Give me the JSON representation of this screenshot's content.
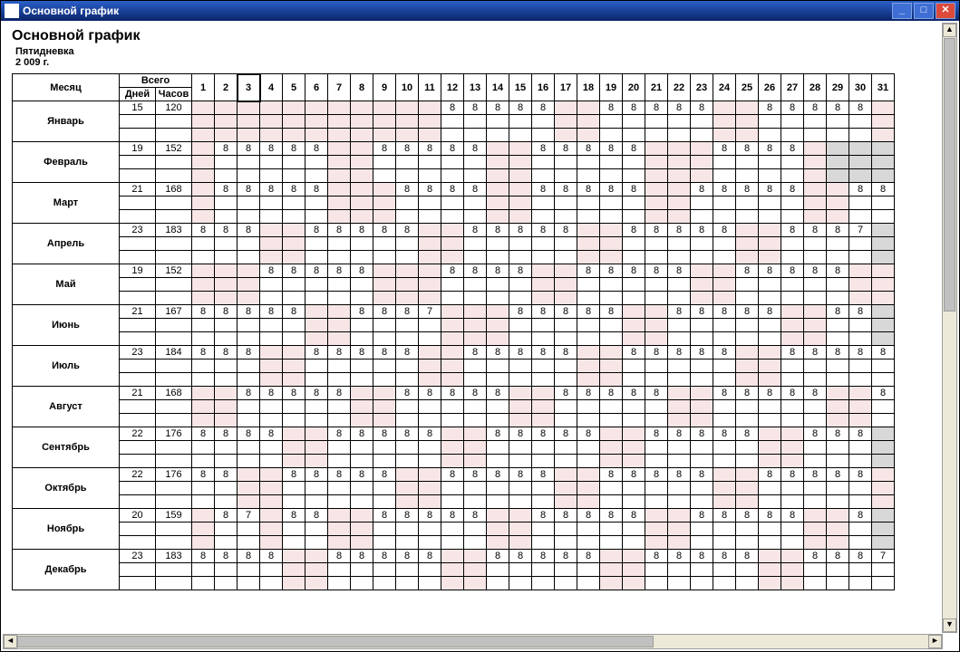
{
  "window": {
    "title": "Основной график"
  },
  "report": {
    "title": "Основной график",
    "subtitle": "Пятидневка",
    "year": "2 009 г."
  },
  "table": {
    "month_header": "Месяц",
    "total_header": "Всего",
    "days_header": "Дней",
    "hours_header": "Часов",
    "columns": [
      1,
      2,
      3,
      4,
      5,
      6,
      7,
      8,
      9,
      10,
      11,
      12,
      13,
      14,
      15,
      16,
      17,
      18,
      19,
      20,
      21,
      22,
      23,
      24,
      25,
      26,
      27,
      28,
      29,
      30,
      31
    ],
    "selected_col": 3
  },
  "months": [
    {
      "name": "Январь",
      "days": 15,
      "hours": 120,
      "weekend": [
        1,
        2,
        3,
        4,
        5,
        6,
        7,
        8,
        9,
        10,
        11,
        17,
        18,
        24,
        25,
        31
      ],
      "gray": [],
      "cells": [
        "",
        "",
        "",
        "",
        "",
        "",
        "",
        "",
        "",
        "",
        "",
        "8",
        "8",
        "8",
        "8",
        "8",
        "",
        "",
        "8",
        "8",
        "8",
        "8",
        "8",
        "",
        "",
        "8",
        "8",
        "8",
        "8",
        "8",
        ""
      ]
    },
    {
      "name": "Февраль",
      "days": 19,
      "hours": 152,
      "weekend": [
        1,
        7,
        8,
        14,
        15,
        21,
        22,
        23,
        28
      ],
      "gray": [
        29,
        30,
        31
      ],
      "cells": [
        "",
        "8",
        "8",
        "8",
        "8",
        "8",
        "",
        "",
        "8",
        "8",
        "8",
        "8",
        "8",
        "",
        "",
        "8",
        "8",
        "8",
        "8",
        "8",
        "",
        "",
        "",
        "8",
        "8",
        "8",
        "8",
        "",
        "",
        "",
        ""
      ]
    },
    {
      "name": "Март",
      "days": 21,
      "hours": 168,
      "weekend": [
        1,
        7,
        8,
        9,
        14,
        15,
        21,
        22,
        28,
        29
      ],
      "gray": [],
      "cells": [
        "",
        "8",
        "8",
        "8",
        "8",
        "8",
        "",
        "",
        "",
        "8",
        "8",
        "8",
        "8",
        "",
        "",
        "8",
        "8",
        "8",
        "8",
        "8",
        "",
        "",
        "8",
        "8",
        "8",
        "8",
        "8",
        "",
        "",
        "8",
        "8"
      ]
    },
    {
      "name": "Апрель",
      "days": 23,
      "hours": 183,
      "weekend": [
        4,
        5,
        11,
        12,
        18,
        19,
        25,
        26
      ],
      "gray": [
        31
      ],
      "cells": [
        "8",
        "8",
        "8",
        "",
        "",
        "8",
        "8",
        "8",
        "8",
        "8",
        "",
        "",
        "8",
        "8",
        "8",
        "8",
        "8",
        "",
        "",
        "8",
        "8",
        "8",
        "8",
        "8",
        "",
        "",
        "8",
        "8",
        "8",
        "7",
        ""
      ]
    },
    {
      "name": "Май",
      "days": 19,
      "hours": 152,
      "weekend": [
        1,
        2,
        3,
        9,
        10,
        11,
        16,
        17,
        23,
        24,
        30,
        31
      ],
      "gray": [],
      "cells": [
        "",
        "",
        "",
        "8",
        "8",
        "8",
        "8",
        "8",
        "",
        "",
        "",
        "8",
        "8",
        "8",
        "8",
        "",
        "",
        "8",
        "8",
        "8",
        "8",
        "8",
        "",
        "",
        "8",
        "8",
        "8",
        "8",
        "8",
        "",
        ""
      ]
    },
    {
      "name": "Июнь",
      "days": 21,
      "hours": 167,
      "weekend": [
        6,
        7,
        12,
        13,
        14,
        20,
        21,
        27,
        28
      ],
      "gray": [
        31
      ],
      "cells": [
        "8",
        "8",
        "8",
        "8",
        "8",
        "",
        "",
        "8",
        "8",
        "8",
        "7",
        "",
        "",
        "",
        "8",
        "8",
        "8",
        "8",
        "8",
        "",
        "",
        "8",
        "8",
        "8",
        "8",
        "8",
        "",
        "",
        "8",
        "8",
        ""
      ]
    },
    {
      "name": "Июль",
      "days": 23,
      "hours": 184,
      "weekend": [
        4,
        5,
        11,
        12,
        18,
        19,
        25,
        26
      ],
      "gray": [],
      "cells": [
        "8",
        "8",
        "8",
        "",
        "",
        "8",
        "8",
        "8",
        "8",
        "8",
        "",
        "",
        "8",
        "8",
        "8",
        "8",
        "8",
        "",
        "",
        "8",
        "8",
        "8",
        "8",
        "8",
        "",
        "",
        "8",
        "8",
        "8",
        "8",
        "8"
      ]
    },
    {
      "name": "Август",
      "days": 21,
      "hours": 168,
      "weekend": [
        1,
        2,
        8,
        9,
        15,
        16,
        22,
        23,
        29,
        30
      ],
      "gray": [],
      "cells": [
        "",
        "",
        "8",
        "8",
        "8",
        "8",
        "8",
        "",
        "",
        "8",
        "8",
        "8",
        "8",
        "8",
        "",
        "",
        "8",
        "8",
        "8",
        "8",
        "8",
        "",
        "",
        "8",
        "8",
        "8",
        "8",
        "8",
        "",
        "",
        "8"
      ]
    },
    {
      "name": "Сентябрь",
      "days": 22,
      "hours": 176,
      "weekend": [
        5,
        6,
        12,
        13,
        19,
        20,
        26,
        27
      ],
      "gray": [
        31
      ],
      "cells": [
        "8",
        "8",
        "8",
        "8",
        "",
        "",
        "8",
        "8",
        "8",
        "8",
        "8",
        "",
        "",
        "8",
        "8",
        "8",
        "8",
        "8",
        "",
        "",
        "8",
        "8",
        "8",
        "8",
        "8",
        "",
        "",
        "8",
        "8",
        "8",
        ""
      ]
    },
    {
      "name": "Октябрь",
      "days": 22,
      "hours": 176,
      "weekend": [
        3,
        4,
        10,
        11,
        17,
        18,
        24,
        25,
        31
      ],
      "gray": [],
      "cells": [
        "8",
        "8",
        "",
        "",
        "8",
        "8",
        "8",
        "8",
        "8",
        "",
        "",
        "8",
        "8",
        "8",
        "8",
        "8",
        "",
        "",
        "8",
        "8",
        "8",
        "8",
        "8",
        "",
        "",
        "8",
        "8",
        "8",
        "8",
        "8",
        ""
      ]
    },
    {
      "name": "Ноябрь",
      "days": 20,
      "hours": 159,
      "weekend": [
        1,
        4,
        7,
        8,
        14,
        15,
        21,
        22,
        28,
        29
      ],
      "gray": [
        31
      ],
      "cells": [
        "",
        "8",
        "7",
        "",
        "8",
        "8",
        "",
        "",
        "8",
        "8",
        "8",
        "8",
        "8",
        "",
        "",
        "8",
        "8",
        "8",
        "8",
        "8",
        "",
        "",
        "8",
        "8",
        "8",
        "8",
        "8",
        "",
        "",
        "8",
        ""
      ]
    },
    {
      "name": "Декабрь",
      "days": 23,
      "hours": 183,
      "weekend": [
        5,
        6,
        12,
        13,
        19,
        20,
        26,
        27
      ],
      "gray": [],
      "cells": [
        "8",
        "8",
        "8",
        "8",
        "",
        "",
        "8",
        "8",
        "8",
        "8",
        "8",
        "",
        "",
        "8",
        "8",
        "8",
        "8",
        "8",
        "",
        "",
        "8",
        "8",
        "8",
        "8",
        "8",
        "",
        "",
        "8",
        "8",
        "8",
        "7"
      ]
    }
  ]
}
